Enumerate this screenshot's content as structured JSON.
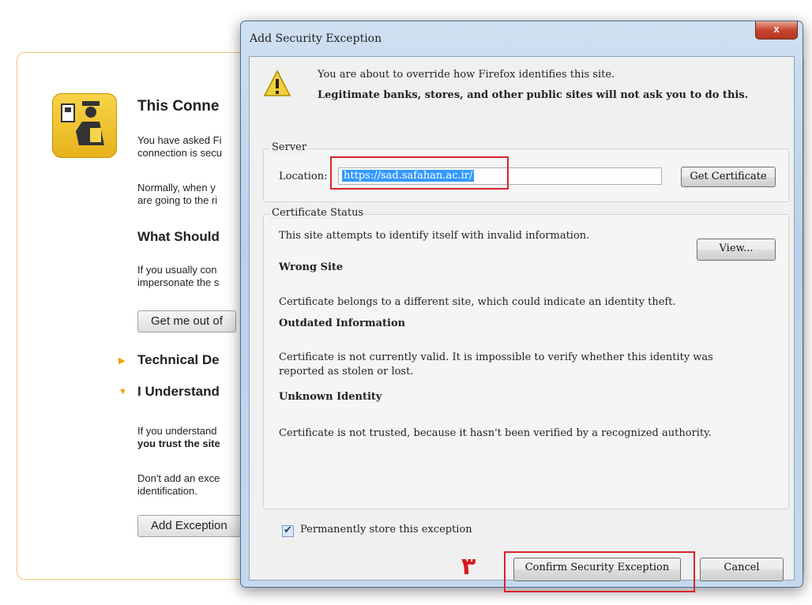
{
  "background": {
    "title": "This Conne",
    "intro_line1": "You have asked Fi",
    "intro_line2": "connection is secu",
    "normal_line1": "Normally, when y",
    "normal_line2": "are going to the ri",
    "what_should": "What Should",
    "usually_line1": "If you usually con",
    "usually_line2": "impersonate the s",
    "get_me_out": "Get me out of",
    "technical": "Technical De",
    "understand": "I Understand",
    "understand_line1": "If you understand",
    "understand_line2": "you trust the site",
    "dont_add_line1": "Don't add an exce",
    "dont_add_line2": "identification.",
    "add_exception": "Add Exception"
  },
  "dialog": {
    "title": "Add Security Exception",
    "close_glyph": "x",
    "message1": "You are about to override how Firefox identifies this site.",
    "message2": "Legitimate banks, stores, and other public sites will not ask you to do this.",
    "server_group": "Server",
    "location_label": "Location:",
    "location_value": "https://sad.safahan.ac.ir/",
    "get_certificate_label": "Get Certificate",
    "status_group": "Certificate Status",
    "status_intro": "This site attempts to identify itself with invalid information.",
    "view_label": "View...",
    "wrong_site_head": "Wrong Site",
    "wrong_site_text": "Certificate belongs to a different site, which could indicate an identity theft.",
    "outdated_head": "Outdated Information",
    "outdated_text1": "Certificate is not currently valid. It is impossible to verify whether this identity was",
    "outdated_text2": "reported as stolen or lost.",
    "unknown_head": "Unknown Identity",
    "unknown_text": "Certificate is not trusted, because it hasn't been verified by a recognized authority.",
    "permanent_label": "Permanently store this exception",
    "permanent_checked": true,
    "step_mark": "٣",
    "confirm_label": "Confirm Security Exception",
    "cancel_label": "Cancel"
  },
  "colors": {
    "highlight_red": "#d9232b",
    "selection_blue": "#3399ff",
    "warning_yellow": "#f7d44a"
  },
  "icons": [
    "identity-officer-icon",
    "warning-triangle-icon",
    "close-icon",
    "checkbox-checked-icon",
    "expand-triangle-icon"
  ]
}
